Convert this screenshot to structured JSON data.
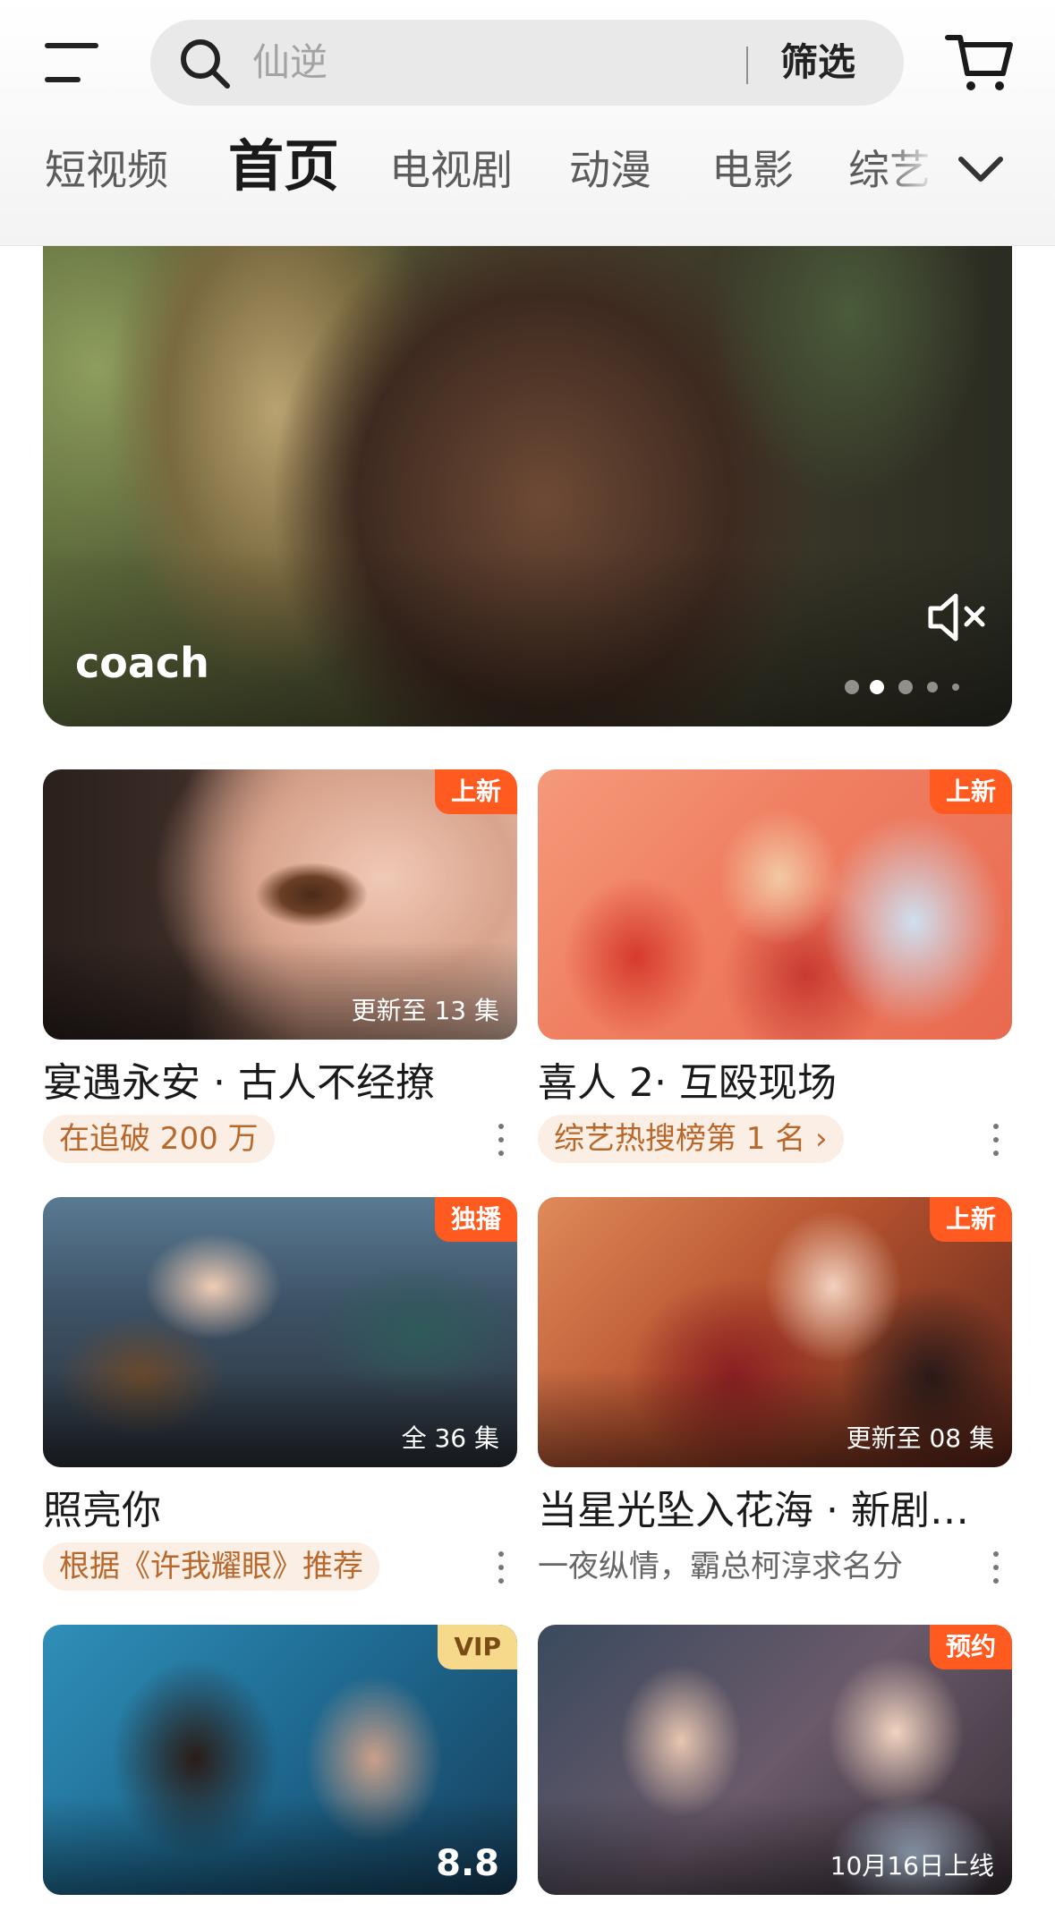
{
  "header": {
    "search_placeholder": "仙逆",
    "filter_label": "筛选"
  },
  "tabs": [
    {
      "label": "短视频",
      "active": false
    },
    {
      "label": "首页",
      "active": true
    },
    {
      "label": "电视剧",
      "active": false
    },
    {
      "label": "动漫",
      "active": false
    },
    {
      "label": "电影",
      "active": false
    },
    {
      "label": "综艺",
      "active": false
    }
  ],
  "hero": {
    "title": "coach",
    "active_dot": 1,
    "dot_count": 5
  },
  "cards": [
    {
      "title": "宴遇永安 · 古人不经撩",
      "tag": "上新",
      "corner": "更新至 13 集",
      "sub": "在追破 200 万",
      "sub_style": "pill"
    },
    {
      "title": "喜人 2· 互殴现场",
      "tag": "上新",
      "corner": "",
      "sub": "综艺热搜榜第 1 名 ›",
      "sub_style": "pill"
    },
    {
      "title": "照亮你",
      "tag": "独播",
      "corner": "全 36 集",
      "sub": "根据《许我耀眼》推荐",
      "sub_style": "pill"
    },
    {
      "title": "当星光坠入花海 · 新剧…",
      "tag": "上新",
      "corner": "更新至 08 集",
      "sub": "一夜纵情，霸总柯淳求名分",
      "sub_style": "plain"
    },
    {
      "title": "",
      "tag": "VIP",
      "corner": "8.8",
      "sub": "",
      "sub_style": "none"
    },
    {
      "title": "",
      "tag": "预约",
      "corner": "10月16日上线",
      "sub": "",
      "sub_style": "none"
    }
  ],
  "colors": {
    "accent_tag": "#ff5a1f",
    "vip_tag": "#f6d98b",
    "pill_text": "#b9682c",
    "pill_bg": "#fbeee4"
  }
}
